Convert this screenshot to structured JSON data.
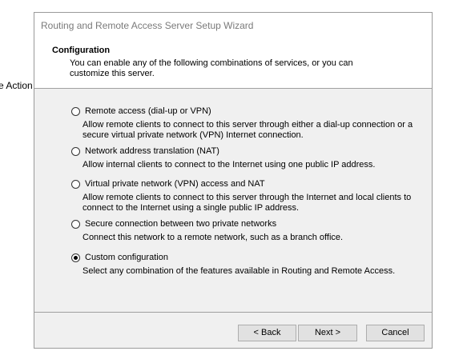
{
  "background": {
    "partial_text": "e Action"
  },
  "window": {
    "title": "Routing and Remote Access Server Setup Wizard"
  },
  "header": {
    "title": "Configuration",
    "description": "You can enable any of the following combinations of services, or you can customize this server."
  },
  "options": [
    {
      "label": "Remote access (dial-up or VPN)",
      "description": "Allow remote clients to connect to this server through either a dial-up connection or a secure virtual private network (VPN) Internet connection.",
      "selected": false
    },
    {
      "label": "Network address translation (NAT)",
      "description": "Allow internal clients to connect to the Internet using one public IP address.",
      "selected": false
    },
    {
      "label": "Virtual private network (VPN) access and NAT",
      "description": "Allow remote clients to connect to this server through the Internet and local clients to connect to the Internet using a single public IP address.",
      "selected": false
    },
    {
      "label": "Secure connection between two private networks",
      "description": "Connect this network to a remote network, such as a branch office.",
      "selected": false
    },
    {
      "label": "Custom configuration",
      "description": "Select any combination of the features available in Routing and Remote Access.",
      "selected": true
    }
  ],
  "buttons": {
    "back": "< Back",
    "next": "Next >",
    "cancel": "Cancel"
  }
}
